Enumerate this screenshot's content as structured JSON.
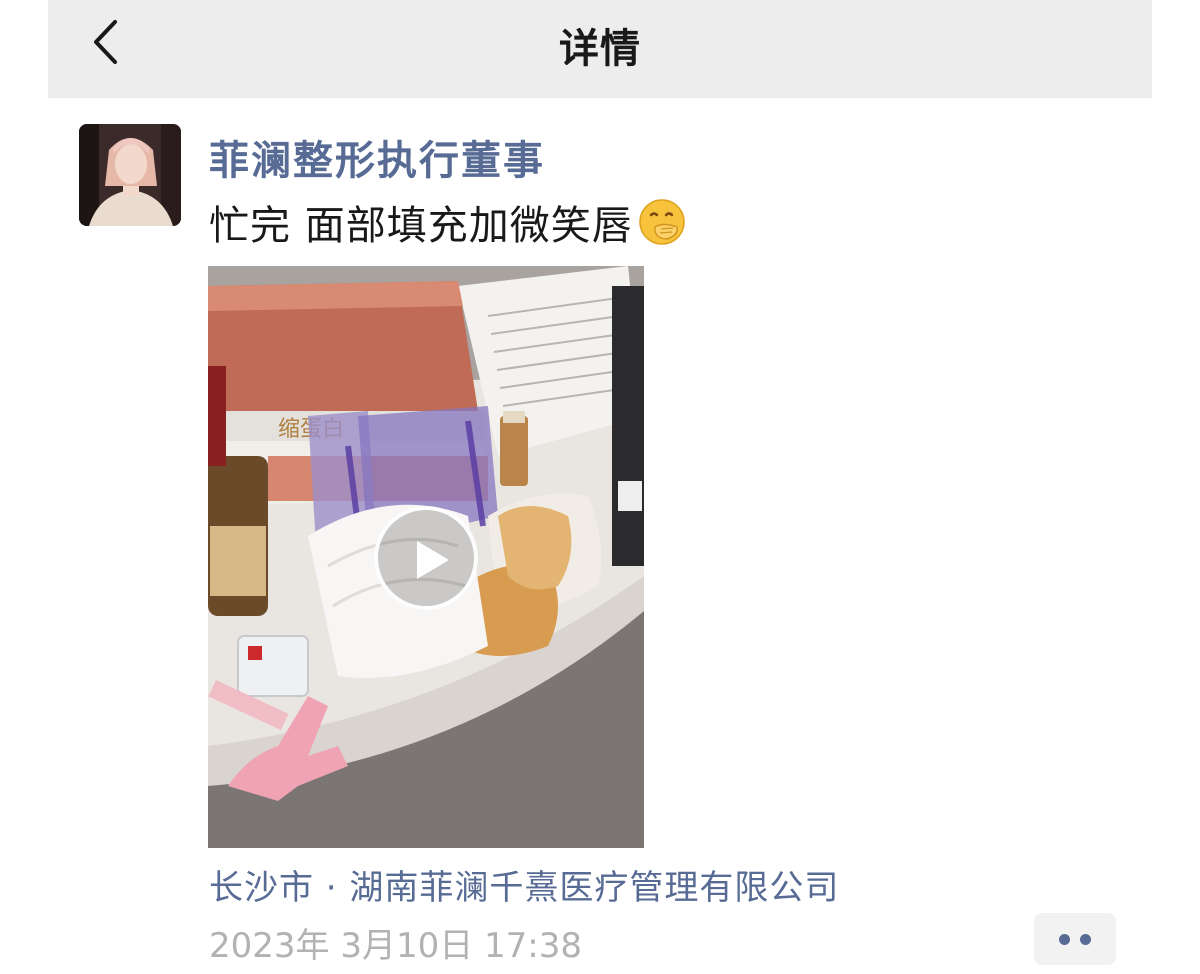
{
  "header": {
    "title": "详情",
    "back_icon": "chevron-left-icon"
  },
  "post": {
    "author": "菲澜整形执行董事",
    "text": "忙完 面部填充加微笑唇",
    "emoji": "hand-over-mouth-emoji",
    "video": {
      "play_icon": "play-icon",
      "box_text": "缩蛋白"
    },
    "location": "长沙市 · 湖南菲澜千熹医疗管理有限公司",
    "timestamp": "2023年 3月10日 17:38",
    "more_icon": "more-dots-icon"
  },
  "colors": {
    "link": "#576b95",
    "header_bg": "#ededed",
    "timestamp": "#b2b2b2"
  }
}
